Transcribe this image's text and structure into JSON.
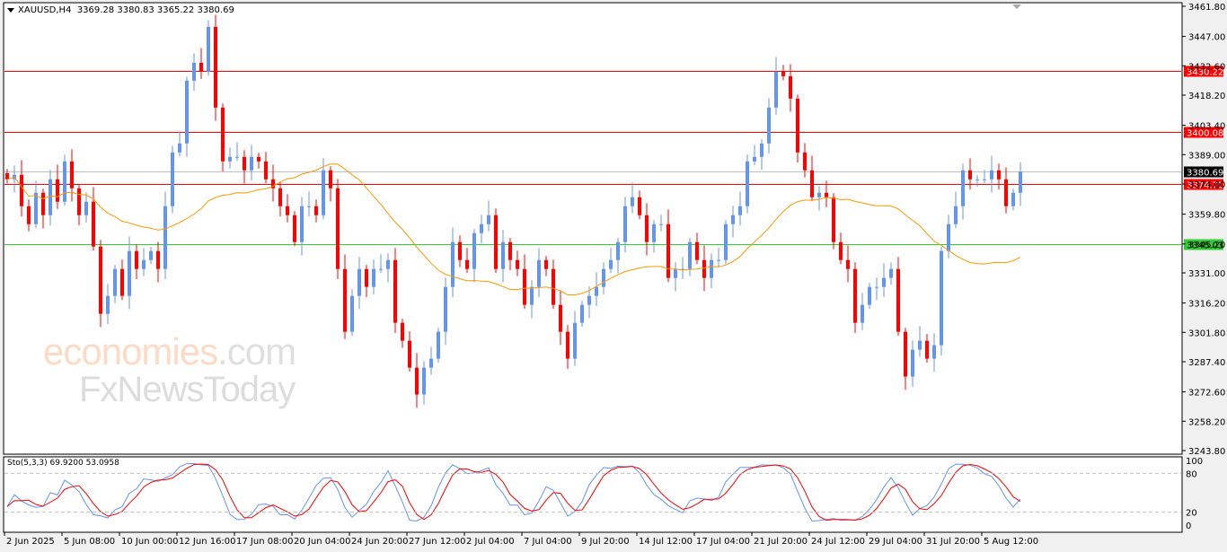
{
  "header": {
    "symbol": "XAUUSD,H4",
    "open": "3369.28",
    "high": "3380.83",
    "low": "3365.22",
    "close": "3380.69"
  },
  "watermark": {
    "brand_main": "economies",
    "brand_suffix": ".com",
    "brand2": "FxNewsToday"
  },
  "stochastic": {
    "label": "Sto(5,3,3)",
    "main": "69.9200",
    "signal": "53.0958",
    "levels": [
      "100",
      "80",
      "20",
      "0"
    ]
  },
  "colors": {
    "bull": "#6495ed",
    "bear": "#ff0000",
    "ma": "#ff9900",
    "resistance": "#ff0000",
    "support": "#32cd32",
    "current": "#c0c0c0",
    "sto_main": "#6495ed",
    "sto_signal": "#ff0000"
  },
  "chart_data": {
    "type": "candlestick",
    "title": "XAUUSD,H4",
    "ylim": [
      3243.8,
      3461.8
    ],
    "y_ticks": [
      "3461.80",
      "3447.00",
      "3432.60",
      "3418.20",
      "3403.40",
      "3389.00",
      "3374.60",
      "3359.80",
      "3345.20",
      "3331.00",
      "3316.20",
      "3301.80",
      "3287.40",
      "3272.60",
      "3258.20",
      "3243.80"
    ],
    "x_tick_labels": [
      "2 Jun 2025",
      "5 Jun 08:00",
      "10 Jun 00:00",
      "12 Jun 16:00",
      "17 Jun 08:00",
      "20 Jun 04:00",
      "24 Jun 20:00",
      "27 Jun 12:00",
      "2 Jul 04:00",
      "7 Jul 04:00",
      "9 Jul 20:00",
      "14 Jul 12:00",
      "17 Jul 04:00",
      "21 Jul 20:00",
      "24 Jul 12:00",
      "29 Jul 04:00",
      "31 Jul 20:00",
      "5 Aug 12:00"
    ],
    "horizontal_lines": [
      {
        "price": 3430.22,
        "label": "3430.22",
        "kind": "resistance"
      },
      {
        "price": 3400.08,
        "label": "3400.08",
        "kind": "resistance"
      },
      {
        "price": 3374.71,
        "label": "3374.71",
        "kind": "resistance"
      },
      {
        "price": 3345.03,
        "label": "3345.03",
        "kind": "support"
      },
      {
        "price": 3380.69,
        "label": "3380.69",
        "kind": "current"
      }
    ],
    "ma_period": 25,
    "closes_sampled": [
      3376.9,
      3379.1,
      3363.7,
      3354.9,
      3370.3,
      3359.3,
      3376.9,
      3365.9,
      3385.7,
      3372.5,
      3359.3,
      3365.9,
      3343.9,
      3310.9,
      3319.7,
      3332.9,
      3319.7,
      3341.7,
      3332.9,
      3337.3,
      3341.7,
      3332.9,
      3363.7,
      3390.1,
      3394.5,
      3425.3,
      3434.1,
      3429.7,
      3451.7,
      3412.1,
      3385.7,
      3387.9,
      3387.9,
      3381.3,
      3387.9,
      3385.7,
      3376.9,
      3372.5,
      3363.7,
      3359.3,
      3346.1,
      3363.7,
      3363.7,
      3359.3,
      3381.3,
      3372.5,
      3332.9,
      3302.1,
      3319.7,
      3332.9,
      3324.1,
      3332.9,
      3332.9,
      3337.3,
      3306.5,
      3297.7,
      3284.5,
      3271.3,
      3284.5,
      3288.9,
      3302.1,
      3324.1,
      3346.1,
      3337.3,
      3332.9,
      3350.5,
      3354.9,
      3359.3,
      3332.9,
      3346.1,
      3337.3,
      3332.9,
      3315.3,
      3324.1,
      3337.3,
      3332.9,
      3315.3,
      3302.1,
      3288.9,
      3306.5,
      3315.3,
      3319.7,
      3324.1,
      3332.9,
      3337.3,
      3346.1,
      3363.7,
      3368.1,
      3359.3,
      3346.1,
      3354.9,
      3354.9,
      3328.5,
      3332.9,
      3332.9,
      3346.1,
      3337.3,
      3328.5,
      3337.3,
      3337.3,
      3354.9,
      3359.3,
      3363.7,
      3385.7,
      3387.9,
      3394.5,
      3412.1,
      3429.7,
      3427.5,
      3416.5,
      3390.1,
      3381.3,
      3368.1,
      3370.3,
      3368.1,
      3346.1,
      3337.3,
      3332.9,
      3306.5,
      3315.3,
      3324.1,
      3324.1,
      3328.5,
      3332.9,
      3302.1,
      3280.1,
      3293.3,
      3297.7,
      3288.9,
      3295.5,
      3341.7,
      3354.9,
      3363.7,
      3381.3,
      3376.9,
      3376.9,
      3376.9,
      3381.3,
      3376.9,
      3363.7,
      3370.3,
      3380.69
    ]
  }
}
